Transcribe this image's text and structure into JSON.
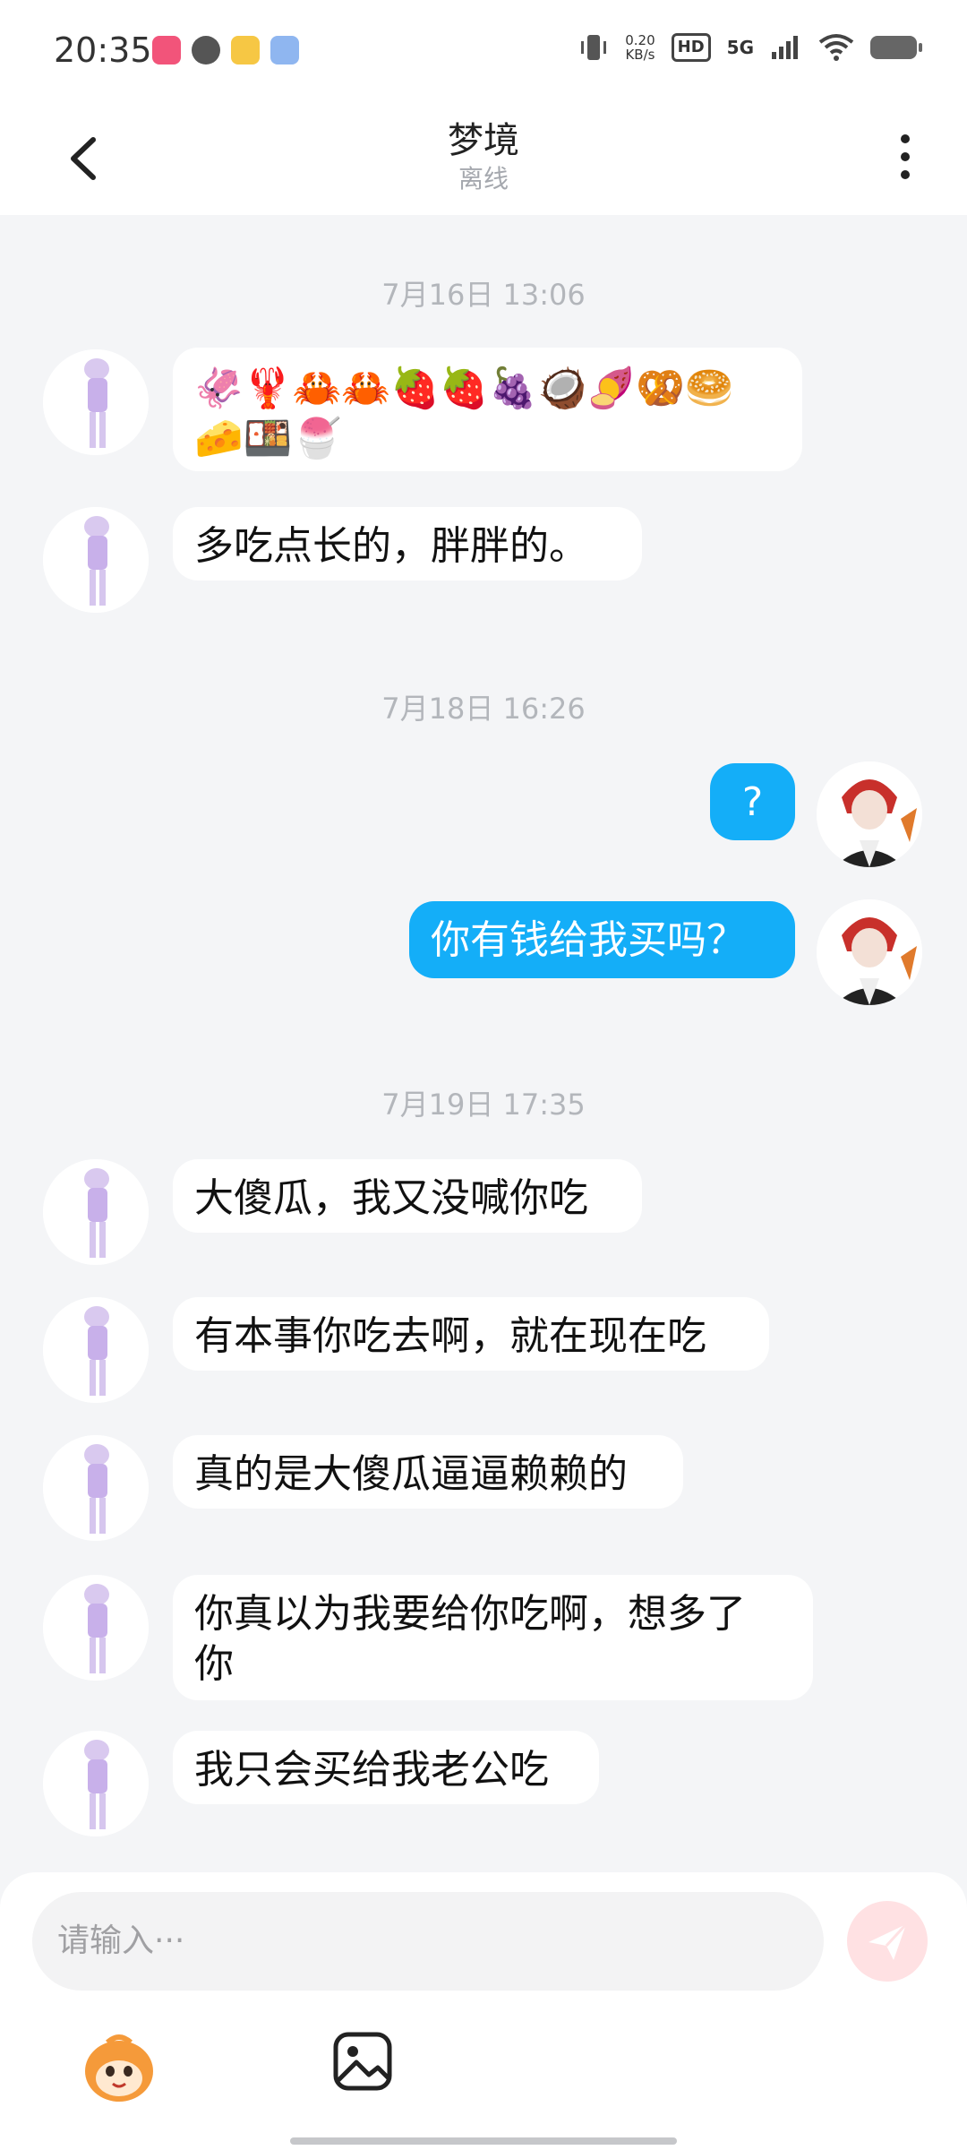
{
  "status_bar": {
    "time": "20:35",
    "net_speed_value": "0.20",
    "net_speed_unit": "KB/s",
    "hd": "HD",
    "network": "5G"
  },
  "header": {
    "title": "梦境",
    "subtitle": "离线",
    "back_icon": "chevron-left-icon",
    "more_icon": "more-vertical-icon"
  },
  "messages": {
    "time1": "7月16日 13:06",
    "emojis_line1": "🦑🦞🦀🦀🍓🍓🍇🥥🍠🥨🥯",
    "emojis_line2": "🧀🍱🍧",
    "m2": "多吃点长的，胖胖的。",
    "time2": "7月18日 16:26",
    "m3": "?",
    "m4": "你有钱给我买吗？",
    "time3": "7月19日 17:35",
    "m5": "大傻瓜，我又没喊你吃",
    "m6": "有本事你吃去啊，就在现在吃",
    "m7": "真的是大傻瓜逼逼赖赖的",
    "m8_line1": "你真以为我要给你吃啊，想多了",
    "m8_line2": "你",
    "m9": "我只会买给我老公吃"
  },
  "composer": {
    "placeholder": "请输入···",
    "send_icon": "send-icon",
    "tool_sticker_icon": "sticker-icon",
    "tool_image_icon": "image-icon"
  },
  "colors": {
    "outgoing_bubble": "#14aef8",
    "incoming_bubble": "#ffffff",
    "background": "#f4f5f7",
    "send_button": "#ffe1e3"
  }
}
